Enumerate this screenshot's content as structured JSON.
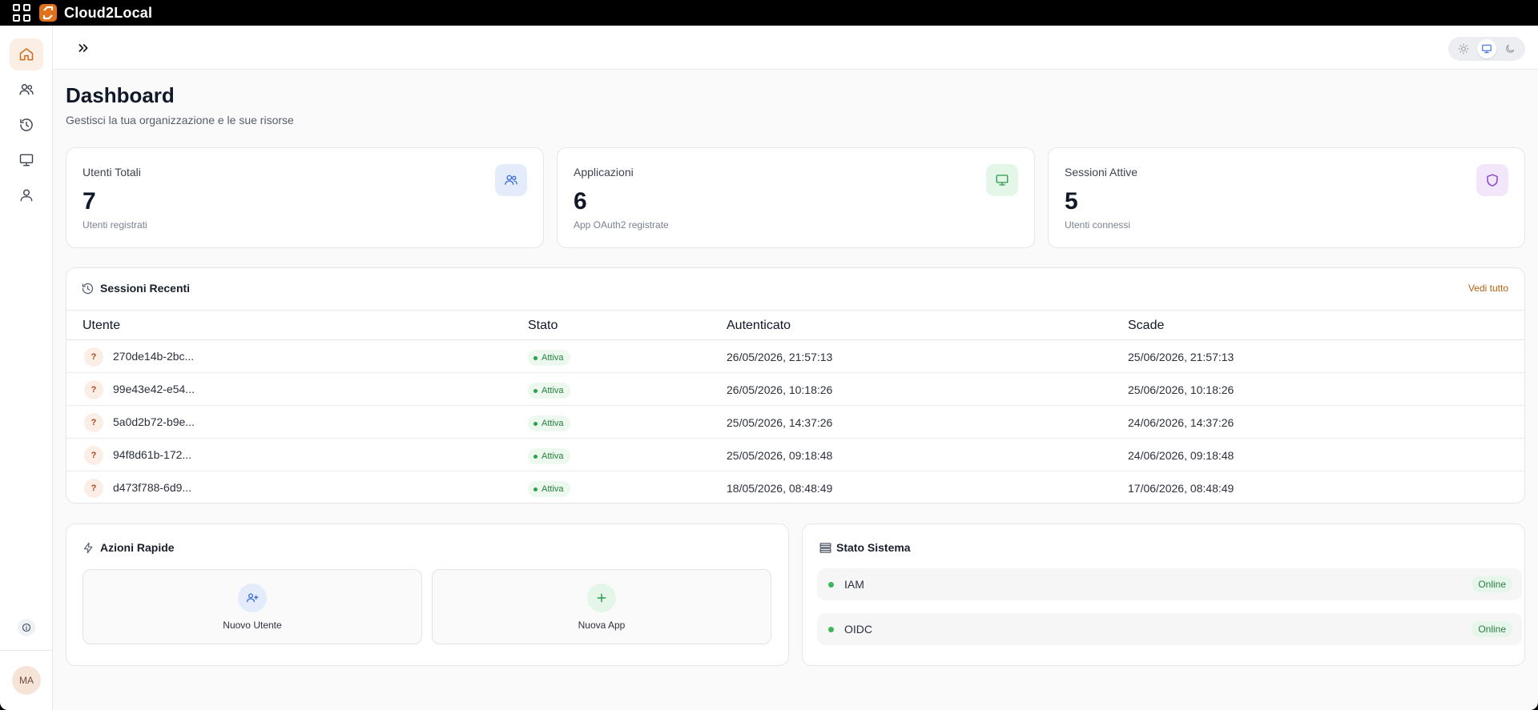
{
  "app": {
    "brand": "Cloud2Local"
  },
  "sidebar": {
    "items": [
      {
        "icon": "home-icon",
        "active": true
      },
      {
        "icon": "users-icon",
        "active": false
      },
      {
        "icon": "history-icon",
        "active": false
      },
      {
        "icon": "monitor-icon",
        "active": false
      },
      {
        "icon": "user-icon",
        "active": false
      }
    ],
    "info_icon": "info-icon",
    "avatar_initials": "MA"
  },
  "header": {
    "expand_icon": "chevrons-right-icon",
    "theme_options": [
      "sun-icon",
      "monitor-icon",
      "moon-icon"
    ],
    "theme_selected": "monitor-icon"
  },
  "page": {
    "title": "Dashboard",
    "subtitle": "Gestisci la tua organizzazione e le sue risorse"
  },
  "stats": [
    {
      "label": "Utenti Totali",
      "value": "7",
      "sub": "Utenti registrati",
      "icon": "users-icon",
      "color": "#3b6fd8",
      "bg": "#e4ecfb"
    },
    {
      "label": "Applicazioni",
      "value": "6",
      "sub": "App OAuth2 registrate",
      "icon": "monitor-icon",
      "color": "#2c9a4c",
      "bg": "#e3f6e8"
    },
    {
      "label": "Sessioni Attive",
      "value": "5",
      "sub": "Utenti connessi",
      "icon": "shield-icon",
      "color": "#8a3ec8",
      "bg": "#f1e6fa"
    }
  ],
  "sessions": {
    "title": "Sessioni Recenti",
    "see_all": "Vedi tutto",
    "columns": [
      "Utente",
      "Stato",
      "Autenticato",
      "Scade"
    ],
    "rows": [
      {
        "avatar": "?",
        "user": "270de14b-2bc...",
        "status": "Attiva",
        "auth": "26/05/2026, 21:57:13",
        "expires": "25/06/2026, 21:57:13"
      },
      {
        "avatar": "?",
        "user": "99e43e42-e54...",
        "status": "Attiva",
        "auth": "26/05/2026, 10:18:26",
        "expires": "25/06/2026, 10:18:26"
      },
      {
        "avatar": "?",
        "user": "5a0d2b72-b9e...",
        "status": "Attiva",
        "auth": "25/05/2026, 14:37:26",
        "expires": "24/06/2026, 14:37:26"
      },
      {
        "avatar": "?",
        "user": "94f8d61b-172...",
        "status": "Attiva",
        "auth": "25/05/2026, 09:18:48",
        "expires": "24/06/2026, 09:18:48"
      },
      {
        "avatar": "?",
        "user": "d473f788-6d9...",
        "status": "Attiva",
        "auth": "18/05/2026, 08:48:49",
        "expires": "17/06/2026, 08:48:49"
      }
    ]
  },
  "quick_actions": {
    "title": "Azioni Rapide",
    "items": [
      {
        "label": "Nuovo Utente",
        "icon": "user-plus-icon"
      },
      {
        "label": "Nuova App",
        "icon": "plus-icon"
      }
    ]
  },
  "system_status": {
    "title": "Stato Sistema",
    "items": [
      {
        "name": "IAM",
        "status": "Online"
      },
      {
        "name": "OIDC",
        "status": "Online"
      }
    ]
  }
}
